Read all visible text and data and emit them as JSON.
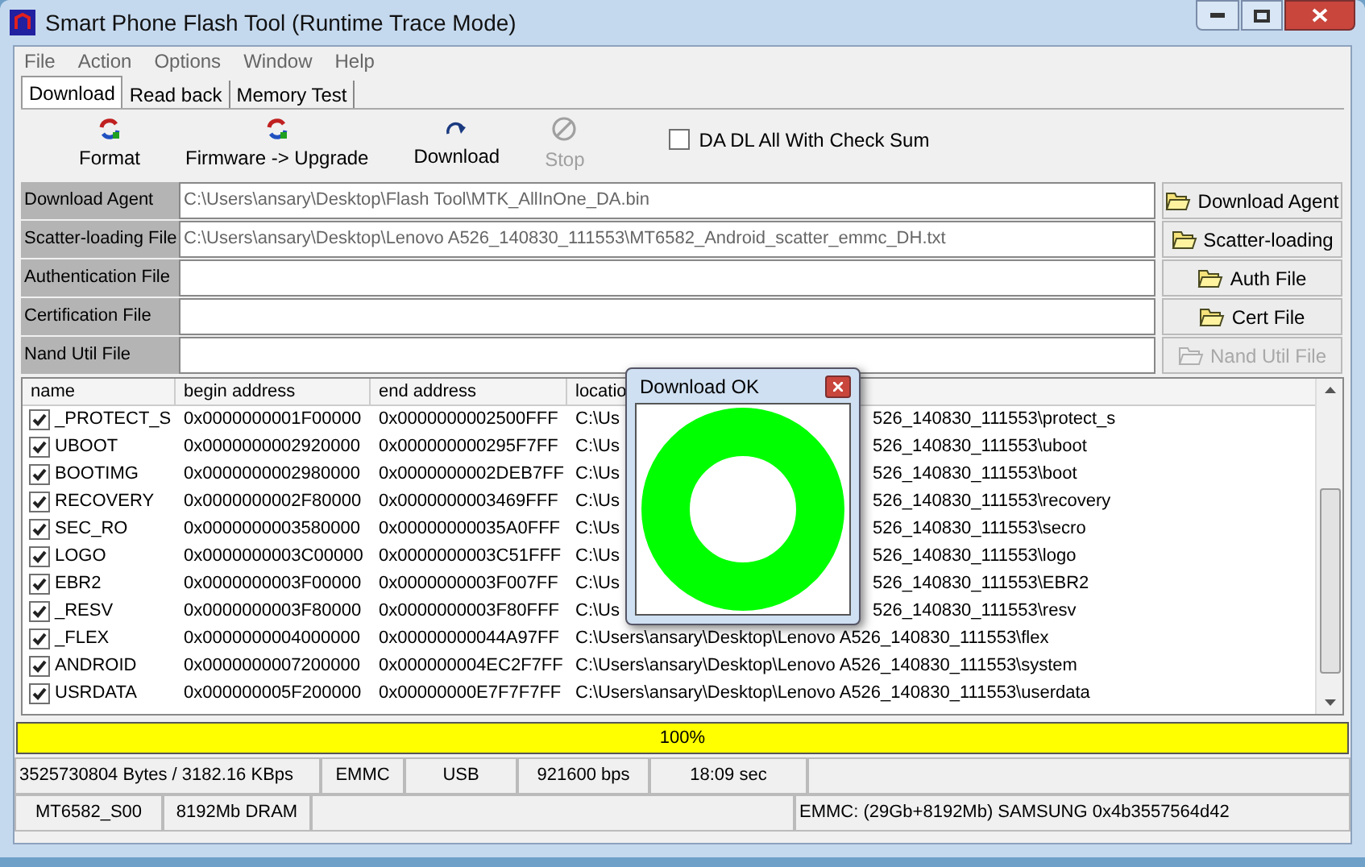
{
  "window": {
    "title": "Smart Phone Flash Tool (Runtime Trace Mode)"
  },
  "menu": [
    "File",
    "Action",
    "Options",
    "Window",
    "Help"
  ],
  "tabs": [
    {
      "label": "Download",
      "selected": true
    },
    {
      "label": "Read back",
      "selected": false
    },
    {
      "label": "Memory Test",
      "selected": false
    }
  ],
  "toolbar": [
    {
      "label": "Format",
      "kind": "format",
      "disabled": false
    },
    {
      "label": "Firmware -> Upgrade",
      "kind": "format",
      "disabled": false
    },
    {
      "label": "Download",
      "kind": "download",
      "disabled": false
    },
    {
      "label": "Stop",
      "kind": "stop",
      "disabled": true
    }
  ],
  "checksum": {
    "label": "DA DL All With Check Sum",
    "checked": false
  },
  "files": [
    {
      "label": "Download Agent",
      "value": "C:\\Users\\ansary\\Desktop\\Flash Tool\\MTK_AllInOne_DA.bin",
      "button": "Download Agent",
      "disabled": false
    },
    {
      "label": "Scatter-loading File",
      "value": "C:\\Users\\ansary\\Desktop\\Lenovo A526_140830_111553\\MT6582_Android_scatter_emmc_DH.txt",
      "button": "Scatter-loading",
      "disabled": false
    },
    {
      "label": "Authentication File",
      "button": "Auth File",
      "disabled": false
    },
    {
      "label": "Certification File",
      "button": "Cert File",
      "disabled": false
    },
    {
      "label": "Nand Util File",
      "button": "Nand Util File",
      "disabled": true
    }
  ],
  "table": {
    "columns": [
      "name",
      "begin address",
      "end address",
      "locatio"
    ],
    "rows": [
      {
        "checked": true,
        "name": "_PROTECT_S",
        "begin": "0x0000000001F00000",
        "end": "0x0000000002500FFF",
        "location": "C:\\Us",
        "location_tail": "526_140830_111553\\protect_s"
      },
      {
        "checked": true,
        "name": "UBOOT",
        "begin": "0x0000000002920000",
        "end": "0x000000000295F7FF",
        "location": "C:\\Us",
        "location_tail": "526_140830_111553\\uboot"
      },
      {
        "checked": true,
        "name": "BOOTIMG",
        "begin": "0x0000000002980000",
        "end": "0x0000000002DEB7FF",
        "location": "C:\\Us",
        "location_tail": "526_140830_111553\\boot"
      },
      {
        "checked": true,
        "name": "RECOVERY",
        "begin": "0x0000000002F80000",
        "end": "0x0000000003469FFF",
        "location": "C:\\Us",
        "location_tail": "526_140830_111553\\recovery"
      },
      {
        "checked": true,
        "name": "SEC_RO",
        "begin": "0x0000000003580000",
        "end": "0x00000000035A0FFF",
        "location": "C:\\Us",
        "location_tail": "526_140830_111553\\secro"
      },
      {
        "checked": true,
        "name": "LOGO",
        "begin": "0x0000000003C00000",
        "end": "0x0000000003C51FFF",
        "location": "C:\\Us",
        "location_tail": "526_140830_111553\\logo"
      },
      {
        "checked": true,
        "name": "EBR2",
        "begin": "0x0000000003F00000",
        "end": "0x0000000003F007FF",
        "location": "C:\\Us",
        "location_tail": "526_140830_111553\\EBR2"
      },
      {
        "checked": true,
        "name": "_RESV",
        "begin": "0x0000000003F80000",
        "end": "0x0000000003F80FFF",
        "location": "C:\\Us",
        "location_tail": "526_140830_111553\\resv"
      },
      {
        "checked": true,
        "name": "_FLEX",
        "begin": "0x0000000004000000",
        "end": "0x00000000044A97FF",
        "location": "C:\\Users\\ansary\\Desktop\\Lenovo A526_140830_111553\\flex"
      },
      {
        "checked": true,
        "name": "ANDROID",
        "begin": "0x0000000007200000",
        "end": "0x000000004EC2F7FF",
        "location": "C:\\Users\\ansary\\Desktop\\Lenovo A526_140830_111553\\system"
      },
      {
        "checked": true,
        "name": "USRDATA",
        "begin": "0x000000005F200000",
        "end": "0x00000000E7F7F7FF",
        "location": "C:\\Users\\ansary\\Desktop\\Lenovo A526_140830_111553\\userdata"
      }
    ]
  },
  "progress": {
    "label": "100%",
    "level": 1
  },
  "status_bar": {
    "row_1": [
      "3525730804 Bytes / 3182.16 KBps",
      "EMMC",
      "USB",
      "921600 bps",
      "18:09 sec"
    ],
    "row_2": [
      "MT6582_S00",
      "8192Mb DRAM",
      "EMMC: (29Gb+8192Mb) SAMSUNG 0x4b3557564d42"
    ]
  },
  "dialog": {
    "title": "Download OK"
  }
}
